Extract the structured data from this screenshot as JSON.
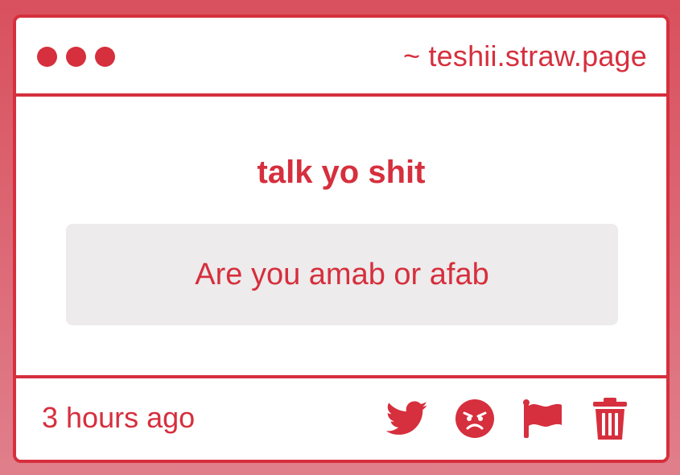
{
  "titlebar": {
    "url": "~ teshii.straw.page"
  },
  "content": {
    "prompt_title": "talk yo shit",
    "question": "Are you amab or afab"
  },
  "footer": {
    "timestamp": "3 hours ago",
    "actions": [
      {
        "icon": "twitter-icon"
      },
      {
        "icon": "angry-face-icon"
      },
      {
        "icon": "flag-icon"
      },
      {
        "icon": "trash-icon"
      }
    ]
  },
  "colors": {
    "accent": "#d62f3d",
    "background_top": "#d9505e",
    "background_bottom": "#e07f8b",
    "question_box": "#edebec",
    "card": "#ffffff"
  }
}
